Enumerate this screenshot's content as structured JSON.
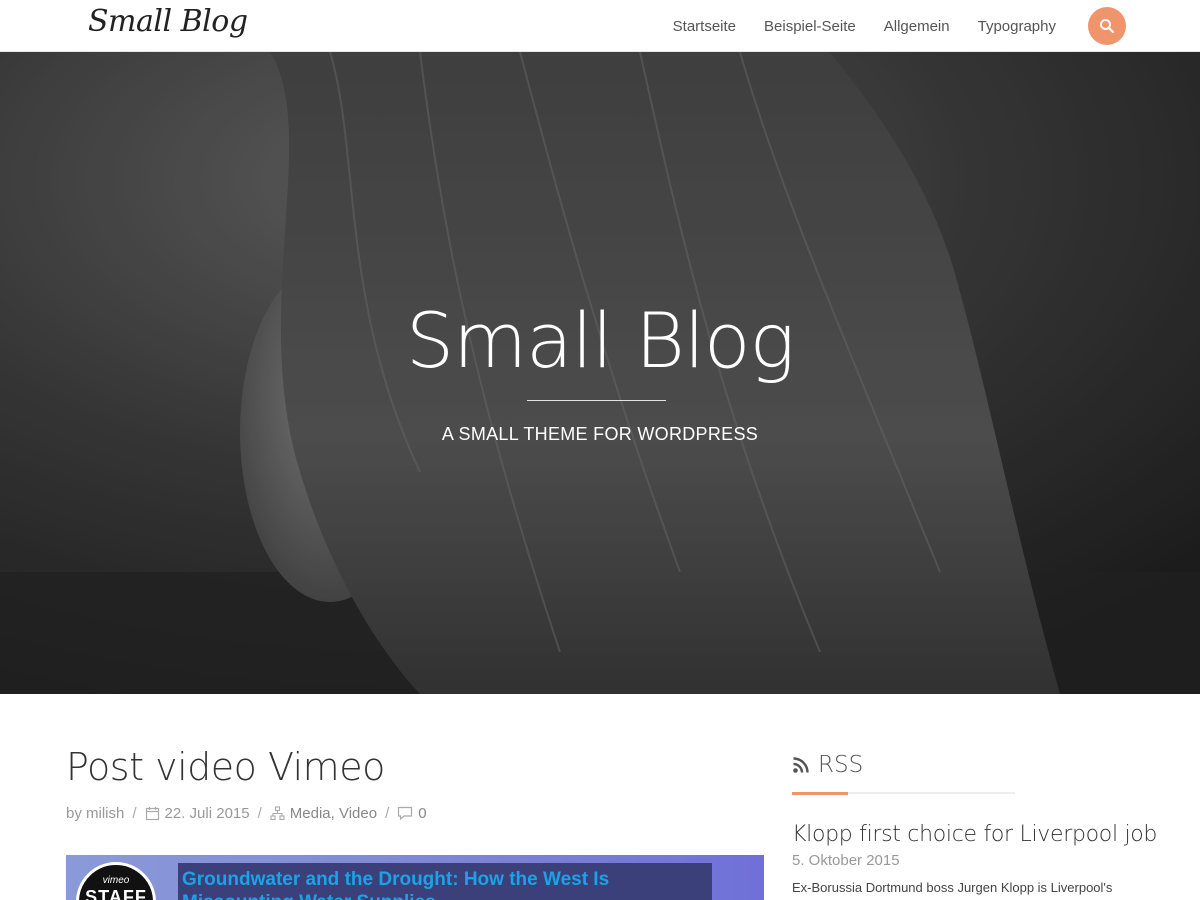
{
  "header": {
    "logo": "Small Blog",
    "nav": [
      "Startseite",
      "Beispiel-Seite",
      "Allgemein",
      "Typography"
    ],
    "search_icon": "search-icon",
    "accent_color": "#f0956b"
  },
  "hero": {
    "title": "Small Blog",
    "tagline": "A SMALL THEME FOR WORDPRESS"
  },
  "post": {
    "title": "Post video Vimeo",
    "meta": {
      "author": "by milish",
      "date": "22. Juli 2015",
      "categories": "Media, Video",
      "comments": "0"
    },
    "video": {
      "badge_top": "vimeo",
      "badge_bottom": "STAFF",
      "title": "Groundwater and the Drought: How the West Is Miscounting Water Supplies"
    }
  },
  "sidebar": {
    "rss_heading": "RSS",
    "feed": {
      "title": "Klopp first choice for Liverpool job",
      "date": "5. Oktober 2015",
      "excerpt": "Ex-Borussia Dortmund boss Jurgen Klopp is Liverpool's"
    }
  }
}
